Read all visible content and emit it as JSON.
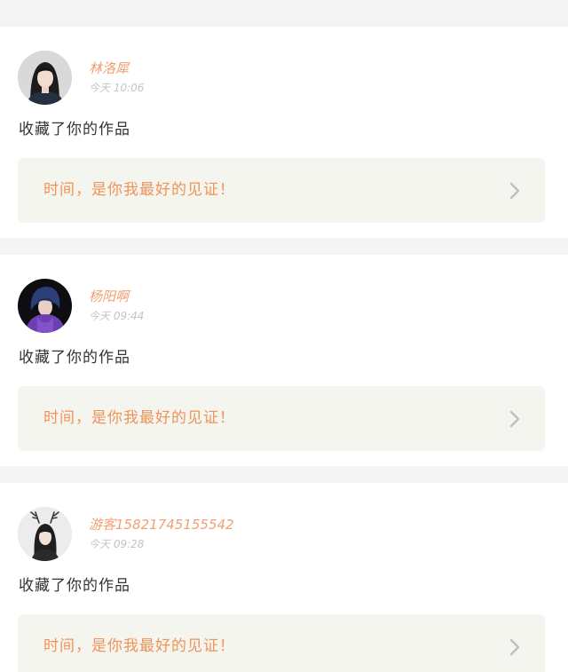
{
  "posts": [
    {
      "username": "林洛犀",
      "time": "今天 10:06",
      "action": "收藏了你的作品",
      "work_title": "时间，是你我最好的见证！",
      "avatar_icon": "user-photo-icon"
    },
    {
      "username": "杨阳啊",
      "time": "今天 09:44",
      "action": "收藏了你的作品",
      "work_title": "时间，是你我最好的见证！",
      "avatar_icon": "user-photo-icon"
    },
    {
      "username": "游客15821745155542",
      "time": "今天 09:28",
      "action": "收藏了你的作品",
      "work_title": "时间，是你我最好的见证！",
      "avatar_icon": "user-photo-icon"
    }
  ],
  "colors": {
    "page_background": "#f4f4f4",
    "card_background": "#ffffff",
    "username": "#f0a072",
    "time": "#c4c4c4",
    "action_text": "#333333",
    "work_box_background": "#f5f5ef",
    "work_title": "#ef9358",
    "chevron": "#bfbfbf"
  }
}
